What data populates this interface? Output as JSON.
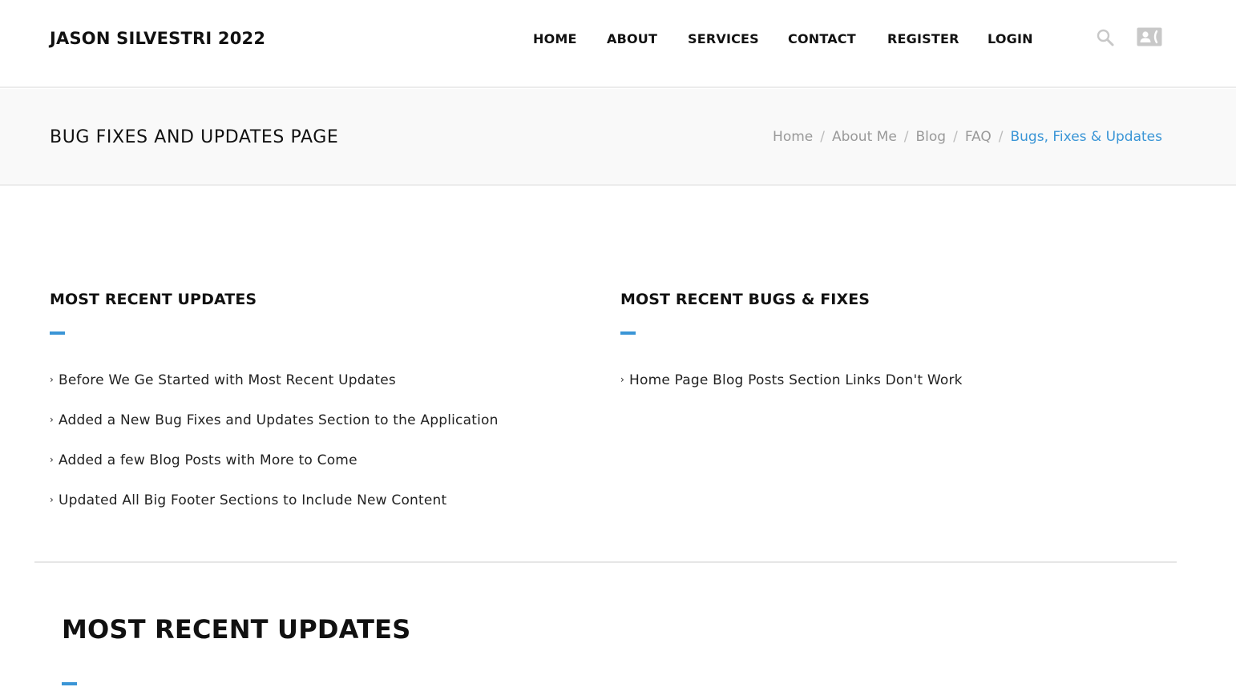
{
  "header": {
    "logo": "JASON SILVESTRI 2022",
    "nav": [
      "HOME",
      "ABOUT",
      "SERVICES",
      "CONTACT",
      "REGISTER",
      "LOGIN"
    ],
    "icons": [
      "search-icon",
      "contact-card-icon"
    ]
  },
  "titlebar": {
    "title": "BUG FIXES AND UPDATES PAGE",
    "breadcrumb": [
      "Home",
      "About Me",
      "Blog",
      "FAQ"
    ],
    "breadcrumb_active": "Bugs, Fixes & Updates",
    "separator": "/"
  },
  "updates": {
    "heading": "MOST RECENT UPDATES",
    "items": [
      "Before We Ge Started with Most Recent Updates",
      "Added a New Bug Fixes and Updates Section to the Application",
      "Added a few Blog Posts with More to Come",
      "Updated All Big Footer Sections to Include New Content"
    ]
  },
  "bugs": {
    "heading": "MOST RECENT BUGS & FIXES",
    "items": [
      "Home Page Blog Posts Section Links Don't Work"
    ]
  },
  "section2": {
    "heading": "MOST RECENT UPDATES"
  },
  "colors": {
    "accent": "#3a95d6",
    "icon_gray": "#c8c8c8"
  }
}
